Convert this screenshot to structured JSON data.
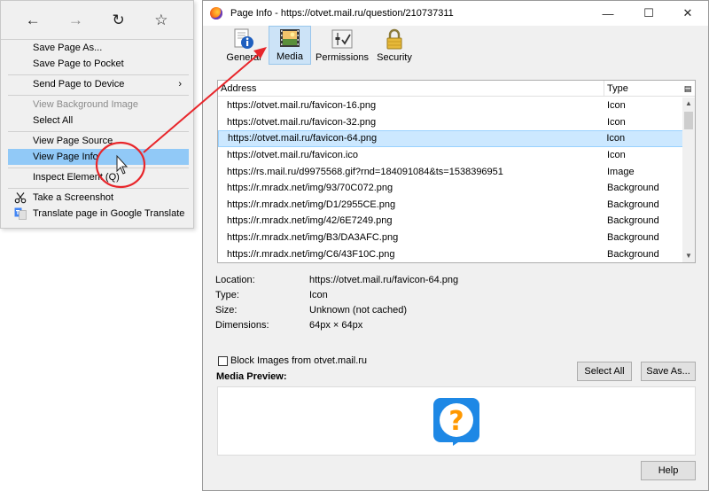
{
  "context_menu": {
    "nav": {
      "back_icon": "arrow-left-icon",
      "forward_icon": "arrow-right-icon",
      "reload_icon": "reload-icon",
      "bookmark_icon": "star-icon"
    },
    "items": [
      {
        "label": "Save Page As...",
        "disabled": false
      },
      {
        "label": "Save Page to Pocket",
        "disabled": false
      },
      {
        "label": "Send Page to Device",
        "disabled": false,
        "submenu": "›"
      },
      {
        "label": "View Background Image",
        "disabled": true
      },
      {
        "label": "Select All",
        "disabled": false
      },
      {
        "label": "View Page Source",
        "disabled": false
      },
      {
        "label": "View Page Info",
        "disabled": false,
        "highlighted": true
      },
      {
        "label": "Inspect Element (Q)",
        "disabled": false
      },
      {
        "label": "Take a Screenshot",
        "disabled": false,
        "icon": "scissors-icon"
      },
      {
        "label": "Translate page in Google Translate",
        "disabled": false,
        "icon": "google-translate-icon"
      }
    ]
  },
  "window": {
    "title": "Page Info - https://otvet.mail.ru/question/210737311",
    "controls": {
      "minimize": "—",
      "maximize": "☐",
      "close": "✕"
    },
    "tabs": [
      {
        "label": "General",
        "icon": "info-icon",
        "active": false
      },
      {
        "label": "Media",
        "icon": "media-icon",
        "active": true
      },
      {
        "label": "Permissions",
        "icon": "permissions-icon",
        "active": false
      },
      {
        "label": "Security",
        "icon": "padlock-icon",
        "active": false
      }
    ],
    "table": {
      "columns": [
        "Address",
        "Type"
      ],
      "rows": [
        {
          "address": "https://otvet.mail.ru/favicon-16.png",
          "type": "Icon",
          "selected": false
        },
        {
          "address": "https://otvet.mail.ru/favicon-32.png",
          "type": "Icon",
          "selected": false
        },
        {
          "address": "https://otvet.mail.ru/favicon-64.png",
          "type": "Icon",
          "selected": true
        },
        {
          "address": "https://otvet.mail.ru/favicon.ico",
          "type": "Icon",
          "selected": false
        },
        {
          "address": "https://rs.mail.ru/d9975568.gif?rnd=184091084&ts=1538396951",
          "type": "Image",
          "selected": false
        },
        {
          "address": "https://r.mradx.net/img/93/70C072.png",
          "type": "Background",
          "selected": false
        },
        {
          "address": "https://r.mradx.net/img/D1/2955CE.png",
          "type": "Background",
          "selected": false
        },
        {
          "address": "https://r.mradx.net/img/42/6E7249.png",
          "type": "Background",
          "selected": false
        },
        {
          "address": "https://r.mradx.net/img/B3/DA3AFC.png",
          "type": "Background",
          "selected": false
        },
        {
          "address": "https://r.mradx.net/img/C6/43F10C.png",
          "type": "Background",
          "selected": false
        }
      ]
    },
    "details": [
      {
        "label": "Location:",
        "value": "https://otvet.mail.ru/favicon-64.png"
      },
      {
        "label": "Type:",
        "value": "Icon"
      },
      {
        "label": "Size:",
        "value": "Unknown (not cached)"
      },
      {
        "label": "Dimensions:",
        "value": "64px × 64px"
      }
    ],
    "block_images_label": "Block Images from otvet.mail.ru",
    "select_all_button": "Select All",
    "save_as_button": "Save As...",
    "media_preview_label": "Media Preview:",
    "preview_glyph": "?",
    "help_button": "Help"
  },
  "colors": {
    "highlight": "#91c9f7",
    "annotation_red": "#e8262b",
    "preview_icon": "#1e88e5",
    "preview_mark": "#ff9800"
  }
}
